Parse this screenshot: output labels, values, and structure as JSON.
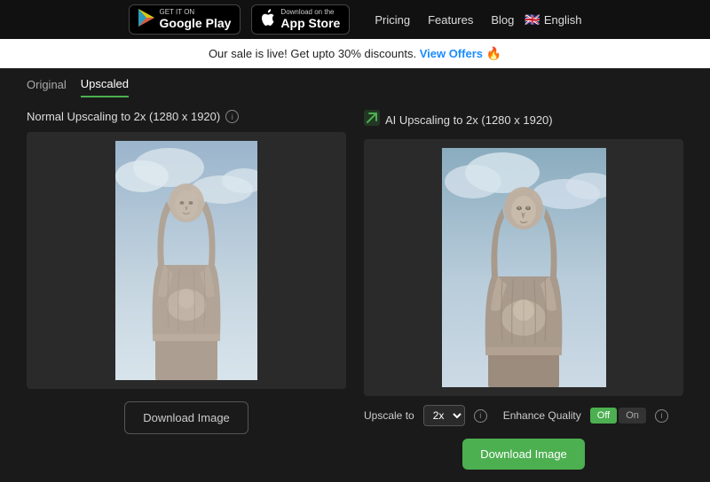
{
  "nav": {
    "google_play_label": "Google Play",
    "google_play_sublabel": "GET IT ON",
    "app_store_label": "App Store",
    "app_store_sublabel": "Download on the",
    "pricing_label": "Pricing",
    "features_label": "Features",
    "blog_label": "Blog",
    "lang_label": "English"
  },
  "promo": {
    "text": "Our sale is live! Get upto 30% discounts.",
    "link_text": "View Offers",
    "emoji": "🔥"
  },
  "tabs": [
    {
      "id": "original",
      "label": "Original",
      "active": false
    },
    {
      "id": "upscaled",
      "label": "Upscaled",
      "active": true
    }
  ],
  "panels": {
    "left": {
      "title": "Normal Upscaling to 2x (1280 x 1920)",
      "download_btn": "Download Image"
    },
    "right": {
      "title": "AI Upscaling to 2x (1280 x 1920)",
      "upscale_label": "Upscale to",
      "upscale_value": "2x",
      "enhance_label": "Enhance Quality",
      "toggle_off": "Off",
      "toggle_on": "On",
      "download_btn": "Download Image"
    }
  },
  "colors": {
    "accent_green": "#4caf50",
    "bg_dark": "#1a1a1a",
    "bg_darker": "#111"
  }
}
